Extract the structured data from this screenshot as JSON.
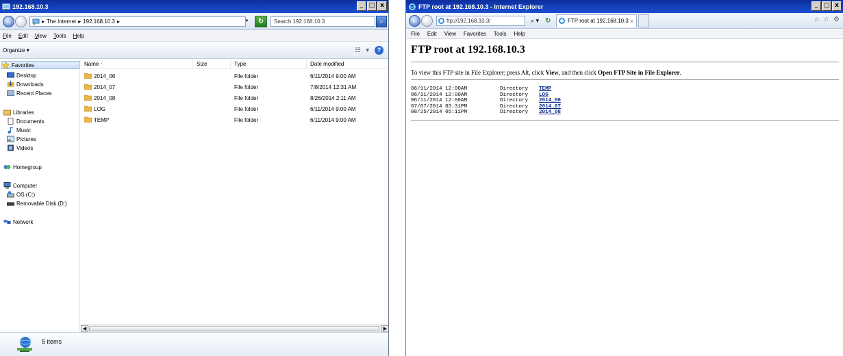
{
  "explorer": {
    "title": "192.168.10.3",
    "address_crumbs": [
      "The Internet",
      "192.168.10.3"
    ],
    "search_placeholder": "Search 192.168.10.3",
    "menu": [
      "File",
      "Edit",
      "View",
      "Tools",
      "Help"
    ],
    "organize_label": "Organize",
    "nav": {
      "favorites": "Favorites",
      "desktop": "Desktop",
      "downloads": "Downloads",
      "recent_places": "Recent Places",
      "libraries": "Libraries",
      "documents": "Documents",
      "music": "Music",
      "pictures": "Pictures",
      "videos": "Videos",
      "homegroup": "Homegroup",
      "computer": "Computer",
      "os_c": "OS (C:)",
      "removable_disk": "Removable Disk (D:)",
      "network": "Network"
    },
    "columns": {
      "name": "Name",
      "size": "Size",
      "type": "Type",
      "date": "Date modified"
    },
    "files": [
      {
        "name": "2014_06",
        "size": "",
        "type": "File folder",
        "date": "6/11/2014 9:00 AM"
      },
      {
        "name": "2014_07",
        "size": "",
        "type": "File folder",
        "date": "7/8/2014 12:31 AM"
      },
      {
        "name": "2014_08",
        "size": "",
        "type": "File folder",
        "date": "8/26/2014 2:11 AM"
      },
      {
        "name": "LOG",
        "size": "",
        "type": "File folder",
        "date": "6/11/2014 9:00 AM"
      },
      {
        "name": "TEMP",
        "size": "",
        "type": "File folder",
        "date": "6/11/2014 9:00 AM"
      }
    ],
    "status": "5 items",
    "colors": {
      "titlebar": "#0b2e9c",
      "folder": "#e8b64a",
      "accent": "#2d6ad0"
    }
  },
  "ie": {
    "title": "FTP root at 192.168.10.3 - Internet Explorer",
    "url": "ftp://192.168.10.3/",
    "tab_title": "FTP root at 192.168.10.3",
    "menu": [
      "File",
      "Edit",
      "View",
      "Favorites",
      "Tools",
      "Help"
    ],
    "heading": "FTP root at 192.168.10.3",
    "instruction": {
      "prefix": "To view this FTP site in File Explorer: press Alt, click ",
      "view": "View",
      "middle": ", and then click ",
      "open_ftp": "Open FTP Site in File Explorer",
      "suffix": "."
    },
    "listing": [
      {
        "date": "06/11/2014 12:00AM",
        "kind": "Directory",
        "name": "TEMP"
      },
      {
        "date": "06/11/2014 12:00AM",
        "kind": "Directory",
        "name": "LOG"
      },
      {
        "date": "06/11/2014 12:00AM",
        "kind": "Directory",
        "name": "2014_06"
      },
      {
        "date": "07/07/2014 03:31PM",
        "kind": "Directory",
        "name": "2014_07"
      },
      {
        "date": "08/25/2014 05:11PM",
        "kind": "Directory",
        "name": "2014_08"
      }
    ],
    "colors": {
      "link": "#0a2a8a"
    }
  }
}
